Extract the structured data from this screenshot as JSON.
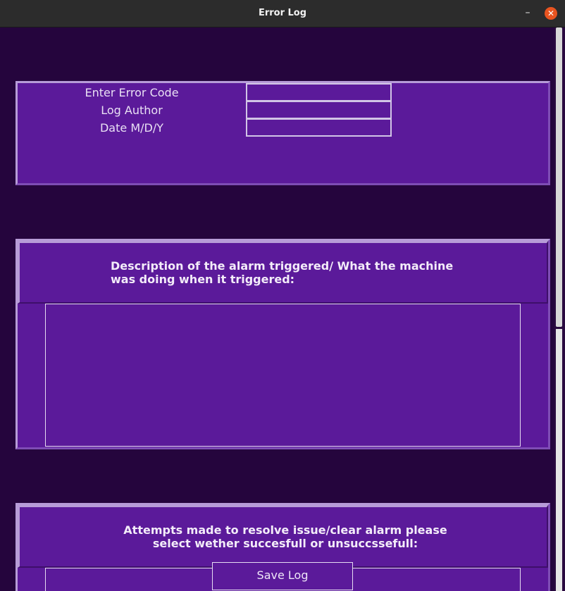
{
  "window": {
    "title": "Error Log",
    "minimize_glyph": "–",
    "close_glyph": "✕",
    "accent_close": "#e95420"
  },
  "form": {
    "error_code_label": "Enter Error Code",
    "error_code_value": "",
    "author_label": "Log Author",
    "author_value": "",
    "date_label": "Date M/D/Y",
    "date_value": ""
  },
  "description": {
    "heading": "Description of the alarm triggered/ What the machine\nwas doing when it triggered:",
    "value": ""
  },
  "resolution": {
    "heading": "Attempts made to resolve issue/clear alarm please\nselect wether succesfull or unsuccssefull:",
    "value": ""
  },
  "actions": {
    "save_label": "Save Log"
  },
  "colors": {
    "background": "#25053d",
    "panel": "#5b1a9a",
    "text": "#e9e0f4"
  }
}
